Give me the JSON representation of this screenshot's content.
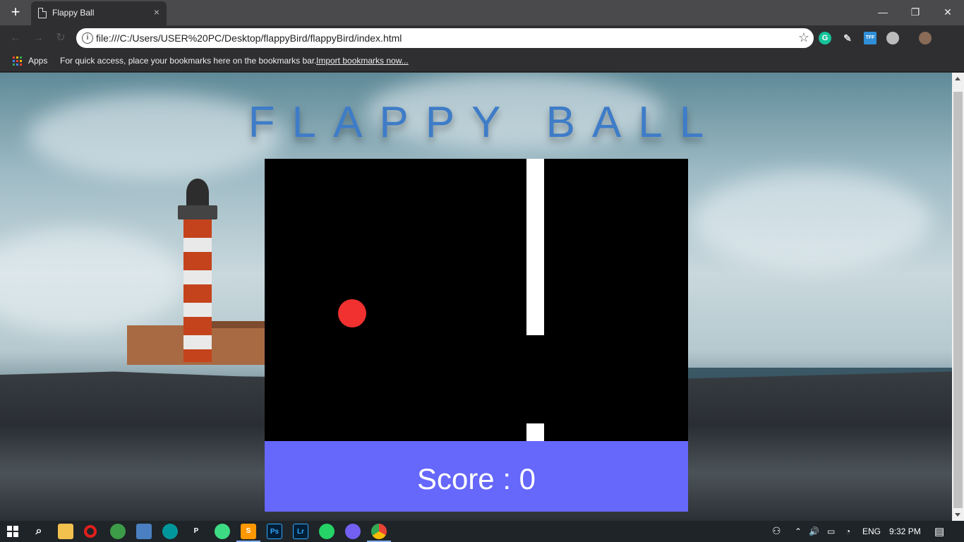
{
  "browser": {
    "tab_title": "Flappy Ball",
    "tab_close": "×",
    "new_tab": "+",
    "url": "file:///C:/Users/USER%20PC/Desktop/flappyBird/flappyBird/index.html",
    "bookmarks": {
      "apps_label": "Apps",
      "hint": "For quick access, place your bookmarks here on the bookmarks bar.",
      "import_link": "Import bookmarks now..."
    },
    "window_controls": {
      "minimize": "—",
      "restore": "❐",
      "close": "✕"
    },
    "extensions": [
      "grammarly-icon",
      "pen-icon",
      "tff-icon",
      "extension-icon",
      "profile-avatar"
    ]
  },
  "game": {
    "title": "FLAPPY BALL",
    "score_text": "Score : 0",
    "colors": {
      "title": "#3e7cc8",
      "canvas": "#000000",
      "pipe": "#ffffff",
      "ball": "#f0312f",
      "score_bar": "#6667fb"
    }
  },
  "taskbar": {
    "apps": [
      "file-explorer-icon",
      "opera-icon",
      "maps-icon",
      "box-icon",
      "arduino-icon",
      "app-icon",
      "android-icon",
      "sublime-icon",
      "photoshop-icon",
      "lightroom-icon",
      "whatsapp-icon",
      "viber-icon",
      "chrome-icon"
    ],
    "photoshop": "Ps",
    "lightroom": "Lr",
    "tray": {
      "language": "ENG",
      "time": "9:32 PM"
    }
  }
}
